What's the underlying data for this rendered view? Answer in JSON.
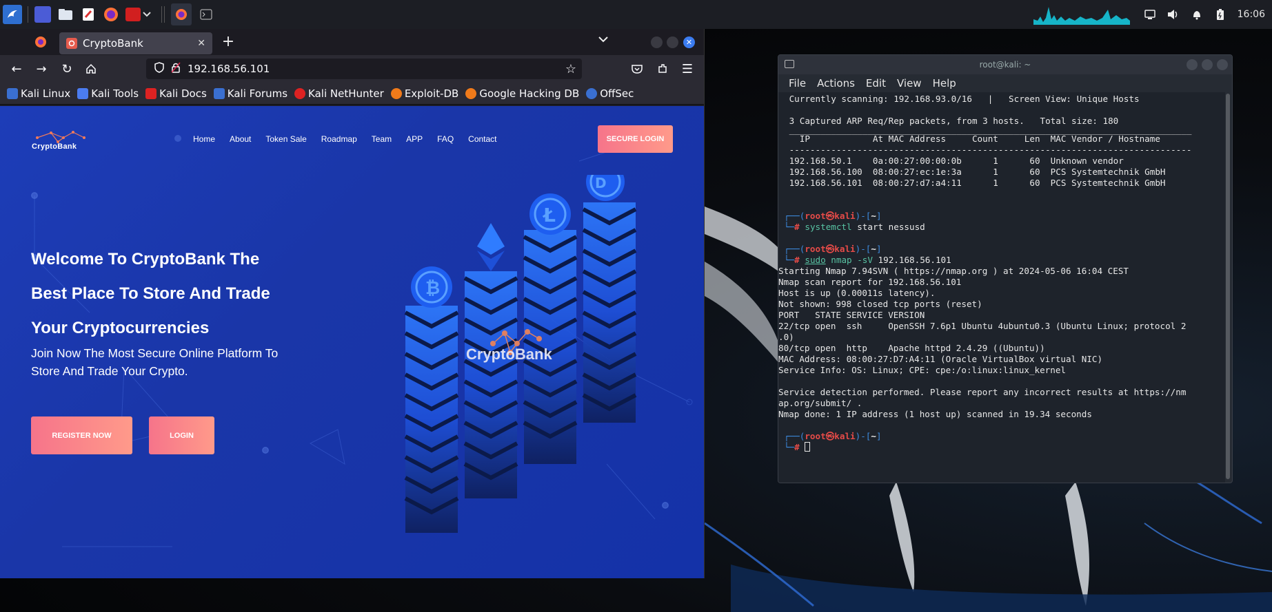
{
  "taskbar": {
    "clock": "16:06",
    "icons": [
      "kali-dragon-icon",
      "workspace-icon",
      "file-manager-icon",
      "text-editor-icon",
      "firefox-icon",
      "terminal-red-icon",
      "chevron-down-icon",
      "firefox-active-icon",
      "terminal-icon"
    ]
  },
  "firefox": {
    "tab_title": "CryptoBank",
    "url": "192.168.56.101",
    "bookmarks": [
      "Kali Linux",
      "Kali Tools",
      "Kali Docs",
      "Kali Forums",
      "Kali NetHunter",
      "Exploit-DB",
      "Google Hacking DB",
      "OffSec"
    ]
  },
  "site": {
    "logo_text": "CryptoBank",
    "nav": [
      "Home",
      "About",
      "Token Sale",
      "Roadmap",
      "Team",
      "APP",
      "FAQ",
      "Contact"
    ],
    "secure_login": "SECURE LOGIN",
    "hero_title_lines": [
      "Welcome To CryptoBank The",
      "Best Place To Store And Trade",
      "Your Cryptocurrencies"
    ],
    "hero_subtitle_lines": [
      "Join Now The Most Secure Online Platform To",
      "Store And Trade Your Crypto."
    ],
    "register_label": "REGISTER NOW",
    "login_label": "LOGIN",
    "illustration_brand": "CryptoBank",
    "colors": {
      "accent": "#f6748a",
      "bg": "#1d3db8"
    }
  },
  "terminal": {
    "title": "root@kali: ~",
    "menu": [
      "File",
      "Actions",
      "Edit",
      "View",
      "Help"
    ],
    "netdiscover": {
      "status": " Currently scanning: 192.168.93.0/16   |   Screen View: Unique Hosts",
      "summary": " 3 Captured ARP Req/Rep packets, from 3 hosts.   Total size: 180",
      "separator": " _____________________________________________________________________________",
      "header": "   IP            At MAC Address     Count     Len  MAC Vendor / Hostname",
      "separator2": " -----------------------------------------------------------------------------",
      "rows": [
        " 192.168.50.1    0a:00:27:00:00:0b      1      60  Unknown vendor",
        " 192.168.56.100  08:00:27:ec:1e:3a      1      60  PCS Systemtechnik GmbH",
        " 192.168.56.101  08:00:27:d7:a4:11      1      60  PCS Systemtechnik GmbH"
      ]
    },
    "prompt": {
      "user": "root",
      "at": "㉿",
      "host": "kali",
      "dir": "~"
    },
    "cmd1": {
      "word": "systemctl",
      "args": " start nessusd"
    },
    "cmd2": {
      "sudo": "sudo",
      "word": " nmap -sV",
      "args": " 192.168.56.101"
    },
    "nmap_output": [
      "Starting Nmap 7.94SVN ( https://nmap.org ) at 2024-05-06 16:04 CEST",
      "Nmap scan report for 192.168.56.101",
      "Host is up (0.00011s latency).",
      "Not shown: 998 closed tcp ports (reset)",
      "PORT   STATE SERVICE VERSION",
      "22/tcp open  ssh     OpenSSH 7.6p1 Ubuntu 4ubuntu0.3 (Ubuntu Linux; protocol 2",
      ".0)",
      "80/tcp open  http    Apache httpd 2.4.29 ((Ubuntu))",
      "MAC Address: 08:00:27:D7:A4:11 (Oracle VirtualBox virtual NIC)",
      "Service Info: OS: Linux; CPE: cpe:/o:linux:linux_kernel",
      "",
      "Service detection performed. Please report any incorrect results at https://nm",
      "ap.org/submit/ .",
      "Nmap done: 1 IP address (1 host up) scanned in 19.34 seconds"
    ]
  }
}
